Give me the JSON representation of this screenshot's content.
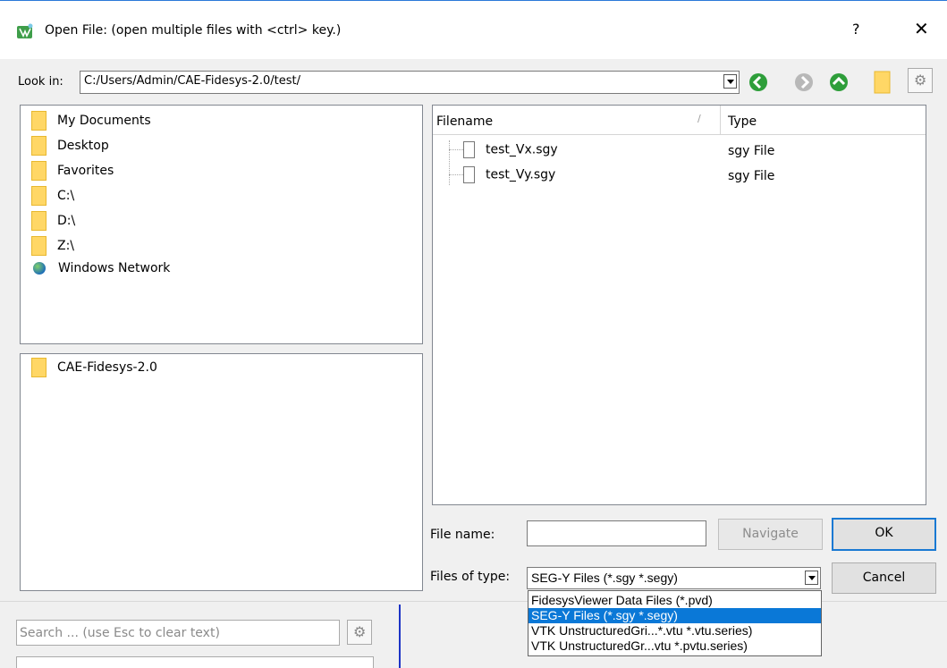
{
  "window": {
    "title": "Open File:  (open multiple files with <ctrl> key.)",
    "help_label": "?",
    "close_label": "✕"
  },
  "toolbar": {
    "look_in_label": "Look in:",
    "look_in_path": "C:/Users/Admin/CAE-Fidesys-2.0/test/",
    "colors": {
      "back": "#2e9e3a",
      "forward": "#b8b8b8",
      "up": "#2e9e3a",
      "folder": "#ffd766"
    }
  },
  "places": [
    {
      "label": "My Documents",
      "icon": "folder-icon"
    },
    {
      "label": "Desktop",
      "icon": "folder-icon"
    },
    {
      "label": "Favorites",
      "icon": "folder-icon"
    },
    {
      "label": "C:\\",
      "icon": "folder-icon"
    },
    {
      "label": "D:\\",
      "icon": "folder-icon"
    },
    {
      "label": "Z:\\",
      "icon": "folder-icon"
    },
    {
      "label": "Windows Network",
      "icon": "network-globe-icon"
    }
  ],
  "recent": [
    {
      "label": "CAE-Fidesys-2.0",
      "icon": "folder-icon"
    }
  ],
  "file_list": {
    "columns": [
      "Filename",
      "Type"
    ],
    "rows": [
      {
        "name": "test_Vx.sgy",
        "type": "sgy File"
      },
      {
        "name": "test_Vy.sgy",
        "type": "sgy File"
      }
    ]
  },
  "form": {
    "file_name_label": "File name:",
    "file_name_value": "",
    "navigate_label": "Navigate",
    "ok_label": "OK",
    "files_of_type_label": "Files of type:",
    "files_of_type_value": "SEG-Y Files (*.sgy *.segy)",
    "cancel_label": "Cancel"
  },
  "type_options": [
    {
      "label": "FidesysViewer Data Files (*.pvd)",
      "selected": false
    },
    {
      "label": "SEG-Y Files (*.sgy *.segy)",
      "selected": true
    },
    {
      "label": "VTK UnstructuredGri...*.vtu *.vtu.series)",
      "selected": false
    },
    {
      "label": "VTK UnstructuredGr...vtu *.pvtu.series)",
      "selected": false
    }
  ],
  "background_panel": {
    "search_placeholder": "Search ... (use Esc to clear text)"
  }
}
